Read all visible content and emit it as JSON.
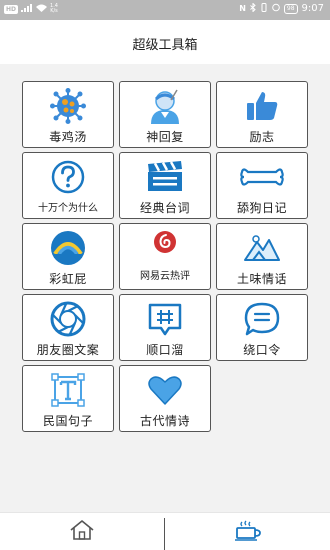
{
  "status": {
    "chip_left": "HD",
    "speed_value": "1.4",
    "speed_unit": "K/s",
    "nfc": "N",
    "battery": "98",
    "time": "9:07"
  },
  "header": {
    "title": "超级工具箱"
  },
  "tiles": [
    {
      "label": "毒鸡汤",
      "icon": "virus-icon"
    },
    {
      "label": "神回复",
      "icon": "person-reply-icon"
    },
    {
      "label": "励志",
      "icon": "thumbs-up-icon"
    },
    {
      "label": "十万个为什么",
      "icon": "question-icon"
    },
    {
      "label": "经典台词",
      "icon": "clapperboard-icon"
    },
    {
      "label": "舔狗日记",
      "icon": "bone-icon"
    },
    {
      "label": "彩虹屁",
      "icon": "rainbow-icon"
    },
    {
      "label": "网易云热评",
      "icon": "netease-music-icon"
    },
    {
      "label": "土味情话",
      "icon": "mountain-icon"
    },
    {
      "label": "朋友圈文案",
      "icon": "camera-aperture-icon"
    },
    {
      "label": "顺口溜",
      "icon": "hash-comment-icon"
    },
    {
      "label": "绕口令",
      "icon": "chat-bubble-icon"
    },
    {
      "label": "民国句子",
      "icon": "text-box-icon"
    },
    {
      "label": "古代情诗",
      "icon": "heart-icon"
    }
  ],
  "nav": {
    "home_icon": "home-icon",
    "coffee_icon": "coffee-cup-icon"
  },
  "colors": {
    "primary_blue": "#1a78c2",
    "light_blue": "#4aa3e6",
    "accent_red": "#d03333",
    "orange": "#f0a020",
    "yellow": "#f2c830"
  }
}
